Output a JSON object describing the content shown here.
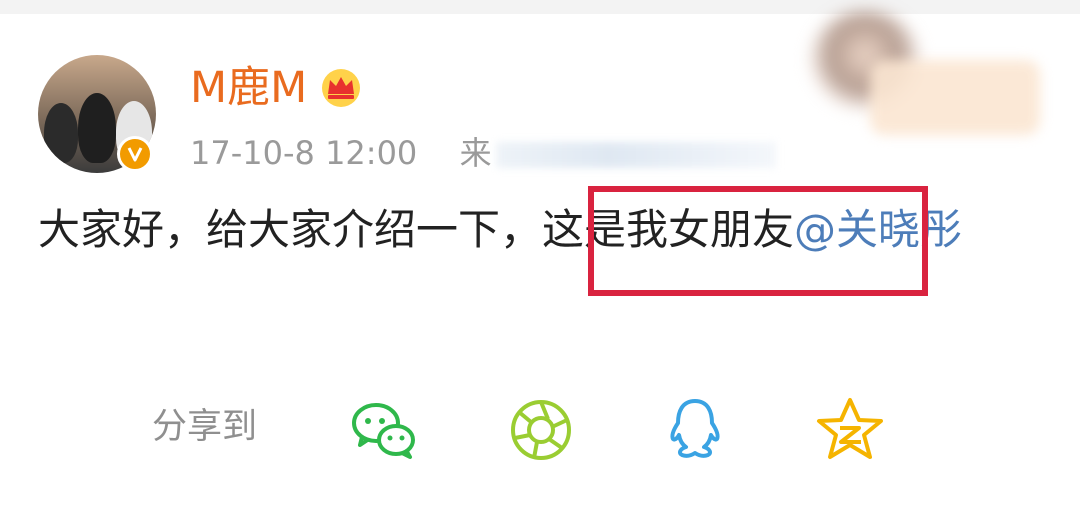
{
  "post": {
    "username": "M鹿M",
    "date": "17-10-8 12:00",
    "source_prefix": "来",
    "text": "大家好，给大家介绍一下，这是我女朋友",
    "mention": "@关晓彤"
  },
  "share": {
    "label": "分享到",
    "targets": [
      "wechat-icon",
      "moments-icon",
      "qq-icon",
      "qzone-icon"
    ]
  },
  "colors": {
    "username": "#e96b1f",
    "mention": "#4d7db9",
    "highlight_box": "#d9233f"
  }
}
